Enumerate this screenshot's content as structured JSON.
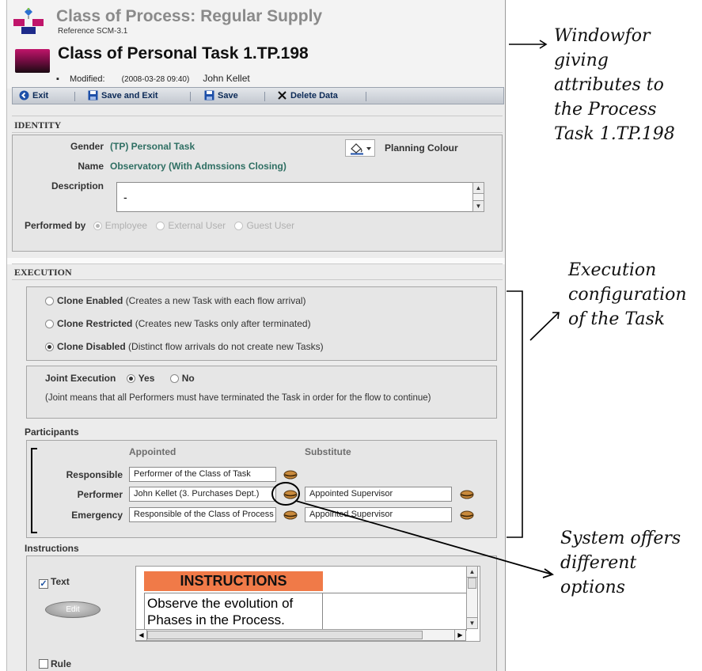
{
  "header": {
    "process_title": "Class of Process: Regular Supply",
    "reference": "Reference SCM-3.1",
    "task_title": "Class of Personal Task 1.TP.198",
    "modified_label": "Modified:",
    "modified_date": "(2008-03-28 09:40)",
    "modified_by": "John Kellet"
  },
  "toolbar": {
    "exit": "Exit",
    "save_exit": "Save and Exit",
    "save": "Save",
    "delete": "Delete Data"
  },
  "identity": {
    "section": "IDENTITY",
    "gender_label": "Gender",
    "gender_value": "(TP) Personal Task",
    "planning_colour": "Planning Colour",
    "name_label": "Name",
    "name_value": "Observatory (With Admssions Closing)",
    "description_label": "Description",
    "description_value": "-",
    "performed_by_label": "Performed by",
    "performed_options": [
      "Employee",
      "External User",
      "Guest User"
    ],
    "performed_selected": "Employee"
  },
  "execution": {
    "section": "EXECUTION",
    "clone_options": [
      {
        "name": "Clone Enabled",
        "note": "(Creates a new Task with each flow arrival)",
        "selected": false
      },
      {
        "name": "Clone Restricted",
        "note": "(Creates new Tasks only after terminated)",
        "selected": false
      },
      {
        "name": "Clone Disabled",
        "note": "(Distinct flow arrivals do not create new Tasks)",
        "selected": true
      }
    ],
    "joint_label": "Joint Execution",
    "joint_yes": "Yes",
    "joint_no": "No",
    "joint_selected": "Yes",
    "joint_note": "(Joint means that all Performers must have terminated the Task in order for the flow to continue)"
  },
  "participants": {
    "section": "Participants",
    "col_appointed": "Appointed",
    "col_substitute": "Substitute",
    "rows": [
      {
        "label": "Responsible",
        "appointed": "Performer of the Class of Task",
        "substitute": ""
      },
      {
        "label": "Performer",
        "appointed": "John Kellet (3. Purchases Dept.)",
        "substitute": "Appointed Supervisor"
      },
      {
        "label": "Emergency",
        "appointed": "Responsible of the Class of Process",
        "substitute": "Appointed Supervisor"
      }
    ]
  },
  "instructions": {
    "section": "Instructions",
    "text_checkbox": "Text",
    "text_checked": true,
    "edit_button": "Edit",
    "heading": "INSTRUCTIONS",
    "body": "Observe the evolution of Phases in the Process.",
    "rule_checkbox": "Rule",
    "rule_checked": false
  },
  "annotations": {
    "window": "Windowfor\ngiving\nattributes to\nthe Process\nTask 1.TP.198",
    "execution": "Execution\nconfiguration\nof the Task",
    "options": "System offers\ndifferent\noptions"
  },
  "colors": {
    "accent_green": "#2f6f63",
    "instructions_header": "#f07a48",
    "toolbar_text": "#0c2a57"
  }
}
